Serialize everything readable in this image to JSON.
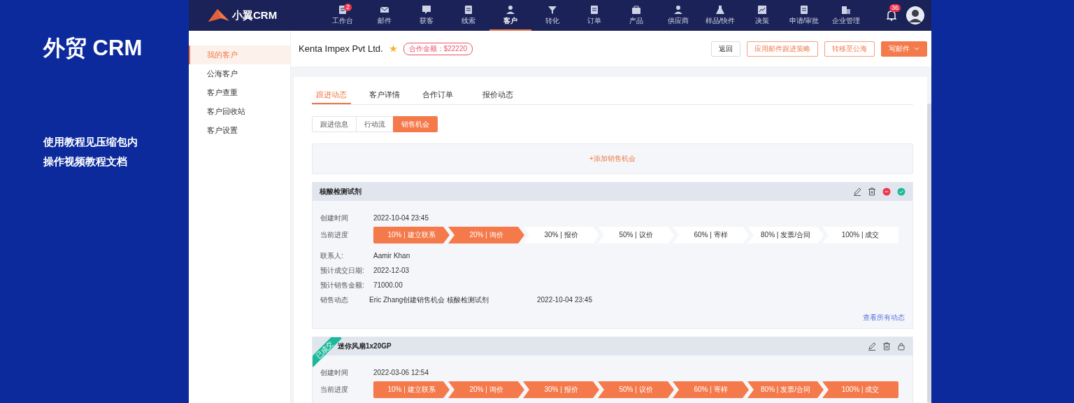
{
  "brand": {
    "title": "外贸 CRM",
    "lines": [
      "使用教程见压缩包内",
      "操作视频教程文档"
    ]
  },
  "app": {
    "logo": "小翼CRM",
    "nav": [
      {
        "label": "工作台",
        "selected": false,
        "badge": "2"
      },
      {
        "label": "邮件",
        "selected": false
      },
      {
        "label": "获客",
        "selected": false
      },
      {
        "label": "线索",
        "selected": false
      },
      {
        "label": "客户",
        "selected": true
      },
      {
        "label": "转化",
        "selected": false
      },
      {
        "label": "订单",
        "selected": false
      },
      {
        "label": "产品",
        "selected": false
      },
      {
        "label": "供应商",
        "selected": false
      },
      {
        "label": "样品/快件",
        "selected": false
      },
      {
        "label": "决策",
        "selected": false
      },
      {
        "label": "申请/审批",
        "selected": false
      },
      {
        "label": "企业管理",
        "selected": false
      }
    ],
    "notifications": "36",
    "sidebar": [
      {
        "label": "我的客户",
        "selected": true
      },
      {
        "label": "公海客户",
        "selected": false
      },
      {
        "label": "客户查重",
        "selected": false
      },
      {
        "label": "客户回收站",
        "selected": false
      },
      {
        "label": "客户设置",
        "selected": false
      }
    ],
    "customer": {
      "name": "Kenta Impex Pvt Ltd.",
      "starred": true,
      "amount_tag": "合作金额：$22220"
    },
    "actions": [
      {
        "label": "返回",
        "kind": "plain"
      },
      {
        "label": "应用邮件跟进策略",
        "kind": "outline"
      },
      {
        "label": "转移至公海",
        "kind": "outline"
      },
      {
        "label": "写邮件",
        "kind": "primary"
      }
    ],
    "tabs": [
      {
        "label": "跟进动态",
        "selected": true
      },
      {
        "label": "客户详情",
        "selected": false
      },
      {
        "label": "合作订单",
        "selected": false
      },
      {
        "label": "报价动态",
        "selected": false
      }
    ],
    "subtabs": [
      {
        "label": "跟进信息",
        "selected": false
      },
      {
        "label": "行动流",
        "selected": false
      },
      {
        "label": "销售机会",
        "selected": true
      }
    ],
    "add_label": "+添加销售机会",
    "opportunities": [
      {
        "title": "核酸检测试剂",
        "closed": false,
        "rows": [
          {
            "kind": "field",
            "label": "创建时间",
            "value": "2022-10-04 23:45"
          },
          {
            "kind": "progress",
            "label": "当前进度",
            "stages": [
              {
                "label": "10% | 建立联系",
                "reached": true
              },
              {
                "label": "20% | 询价",
                "reached": true
              },
              {
                "label": "30% | 报价",
                "reached": false
              },
              {
                "label": "50% | 议价",
                "reached": false
              },
              {
                "label": "60% | 寄样",
                "reached": false
              },
              {
                "label": "80% | 发票/合同",
                "reached": false
              },
              {
                "label": "100% | 成交",
                "reached": false
              }
            ]
          },
          {
            "kind": "field",
            "label": "联系人:",
            "value": "Aamir Khan"
          },
          {
            "kind": "field",
            "label": "预计成交日期:",
            "value": "2022-12-03"
          },
          {
            "kind": "field",
            "label": "预计销售金额:",
            "value": "71000.00"
          },
          {
            "kind": "activity",
            "label": "销售动态",
            "value": "Eric Zhang创建销售机会 核酸检测试剂",
            "time": "2022-10-04 23:45"
          }
        ],
        "link": "查看所有动态"
      },
      {
        "title": "迷你风扇1x20GP",
        "closed": true,
        "ribbon": "已成交",
        "rows": [
          {
            "kind": "field",
            "label": "创建时间",
            "value": "2022-03-06 12:54"
          },
          {
            "kind": "progress",
            "label": "当前进度",
            "stages": [
              {
                "label": "10% | 建立联系",
                "reached": true
              },
              {
                "label": "20% | 询价",
                "reached": true
              },
              {
                "label": "30% | 报价",
                "reached": true
              },
              {
                "label": "50% | 议价",
                "reached": true
              },
              {
                "label": "60% | 寄样",
                "reached": true
              },
              {
                "label": "80% | 发票/合同",
                "reached": true
              },
              {
                "label": "100% | 成交",
                "reached": true
              }
            ]
          }
        ]
      }
    ]
  }
}
